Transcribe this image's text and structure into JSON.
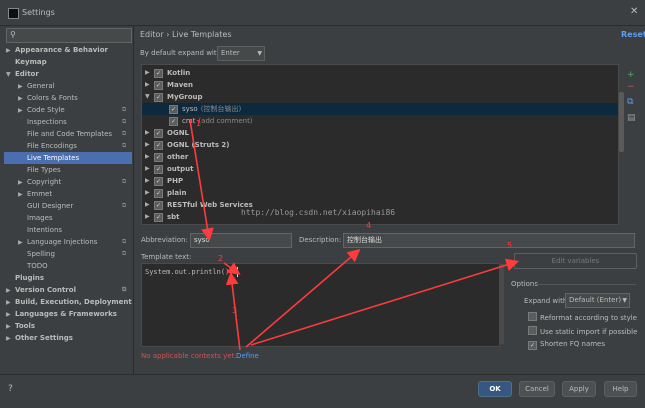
{
  "window": {
    "title": "Settings",
    "close": "✕"
  },
  "search": {
    "icon": "search-icon",
    "placeholder": ""
  },
  "tree": [
    {
      "label": "Appearance & Behavior",
      "bold": true,
      "arrow": "▶",
      "indent": 0
    },
    {
      "label": "Keymap",
      "bold": true,
      "arrow": "",
      "indent": 0
    },
    {
      "label": "Editor",
      "bold": true,
      "arrow": "▼",
      "indent": 0
    },
    {
      "label": "General",
      "bold": false,
      "arrow": "▶",
      "indent": 1
    },
    {
      "label": "Colors & Fonts",
      "bold": false,
      "arrow": "▶",
      "indent": 1
    },
    {
      "label": "Code Style",
      "bold": false,
      "arrow": "▶",
      "indent": 1,
      "mark": true
    },
    {
      "label": "Inspections",
      "bold": false,
      "arrow": "",
      "indent": 1,
      "mark": true
    },
    {
      "label": "File and Code Templates",
      "bold": false,
      "arrow": "",
      "indent": 1,
      "mark": true
    },
    {
      "label": "File Encodings",
      "bold": false,
      "arrow": "",
      "indent": 1,
      "mark": true
    },
    {
      "label": "Live Templates",
      "bold": false,
      "arrow": "",
      "indent": 1,
      "selected": true
    },
    {
      "label": "File Types",
      "bold": false,
      "arrow": "",
      "indent": 1
    },
    {
      "label": "Copyright",
      "bold": false,
      "arrow": "▶",
      "indent": 1,
      "mark": true
    },
    {
      "label": "Emmet",
      "bold": false,
      "arrow": "▶",
      "indent": 1
    },
    {
      "label": "GUI Designer",
      "bold": false,
      "arrow": "",
      "indent": 1,
      "mark": true
    },
    {
      "label": "Images",
      "bold": false,
      "arrow": "",
      "indent": 1
    },
    {
      "label": "Intentions",
      "bold": false,
      "arrow": "",
      "indent": 1
    },
    {
      "label": "Language Injections",
      "bold": false,
      "arrow": "▶",
      "indent": 1,
      "mark": true
    },
    {
      "label": "Spelling",
      "bold": false,
      "arrow": "",
      "indent": 1,
      "mark": true
    },
    {
      "label": "TODO",
      "bold": false,
      "arrow": "",
      "indent": 1
    },
    {
      "label": "Plugins",
      "bold": true,
      "arrow": "",
      "indent": 0
    },
    {
      "label": "Version Control",
      "bold": true,
      "arrow": "▶",
      "indent": 0,
      "mark": true
    },
    {
      "label": "Build, Execution, Deployment",
      "bold": true,
      "arrow": "▶",
      "indent": 0
    },
    {
      "label": "Languages & Frameworks",
      "bold": true,
      "arrow": "▶",
      "indent": 0
    },
    {
      "label": "Tools",
      "bold": true,
      "arrow": "▶",
      "indent": 0
    },
    {
      "label": "Other Settings",
      "bold": true,
      "arrow": "▶",
      "indent": 0
    }
  ],
  "header": {
    "breadcrumb": "Editor › Live Templates",
    "reset": "Reset"
  },
  "expand": {
    "label": "By default expand with",
    "value": "Enter"
  },
  "templates": [
    {
      "label": "Kotlin",
      "group": true,
      "open": false,
      "checked": true,
      "desc": ""
    },
    {
      "label": "Maven",
      "group": true,
      "open": false,
      "checked": true,
      "desc": ""
    },
    {
      "label": "MyGroup",
      "group": true,
      "open": true,
      "checked": true,
      "desc": ""
    },
    {
      "label": "syso",
      "group": false,
      "checked": true,
      "desc": "(控制台输出)",
      "selected": true
    },
    {
      "label": "cmt",
      "group": false,
      "checked": true,
      "desc": "(add comment)"
    },
    {
      "label": "OGNL",
      "group": true,
      "open": false,
      "checked": true,
      "desc": ""
    },
    {
      "label": "OGNL (Struts 2)",
      "group": true,
      "open": false,
      "checked": true,
      "desc": ""
    },
    {
      "label": "other",
      "group": true,
      "open": false,
      "checked": true,
      "desc": ""
    },
    {
      "label": "output",
      "group": true,
      "open": false,
      "checked": true,
      "desc": ""
    },
    {
      "label": "PHP",
      "group": true,
      "open": false,
      "checked": true,
      "desc": ""
    },
    {
      "label": "plain",
      "group": true,
      "open": false,
      "checked": true,
      "desc": ""
    },
    {
      "label": "RESTful Web Services",
      "group": true,
      "open": false,
      "checked": true,
      "desc": ""
    },
    {
      "label": "sbt",
      "group": true,
      "open": false,
      "checked": true,
      "desc": ""
    }
  ],
  "watermark": "http://blog.csdn.net/xiaopihai86",
  "side_buttons": [
    {
      "icon": "add-icon",
      "glyph": "+",
      "color": "#59a869"
    },
    {
      "icon": "remove-icon",
      "glyph": "−",
      "color": "#d25252"
    },
    {
      "icon": "copy-icon",
      "glyph": "⧉",
      "color": "#589df6"
    },
    {
      "icon": "restore-icon",
      "glyph": "▤",
      "color": "#9a9a9a"
    }
  ],
  "form": {
    "abbr_label": "Abbreviation:",
    "abbr_value": "syso",
    "desc_label": "Description:",
    "desc_value": "控制台输出",
    "template_label": "Template text:",
    "template_value": "System.out.println();",
    "edit_variables": "Edit variables"
  },
  "options": {
    "title": "Options",
    "expand_label": "Expand with",
    "expand_value": "Default (Enter)",
    "reformat": "Reformat according to style",
    "reformat_checked": false,
    "static_import": "Use static import if possible",
    "static_import_checked": false,
    "shorten": "Shorten FQ names",
    "shorten_checked": true
  },
  "context": {
    "warning": "No applicable contexts yet.",
    "define": "Define"
  },
  "buttons": {
    "ok": "OK",
    "cancel": "Cancel",
    "apply": "Apply",
    "help": "Help"
  },
  "annotations": [
    "1",
    "2",
    "3",
    "4",
    "5"
  ],
  "colors": {
    "accent": "#4b6eaf",
    "link": "#589df6",
    "error": "#d25252",
    "annotation": "#ff3b3b"
  }
}
